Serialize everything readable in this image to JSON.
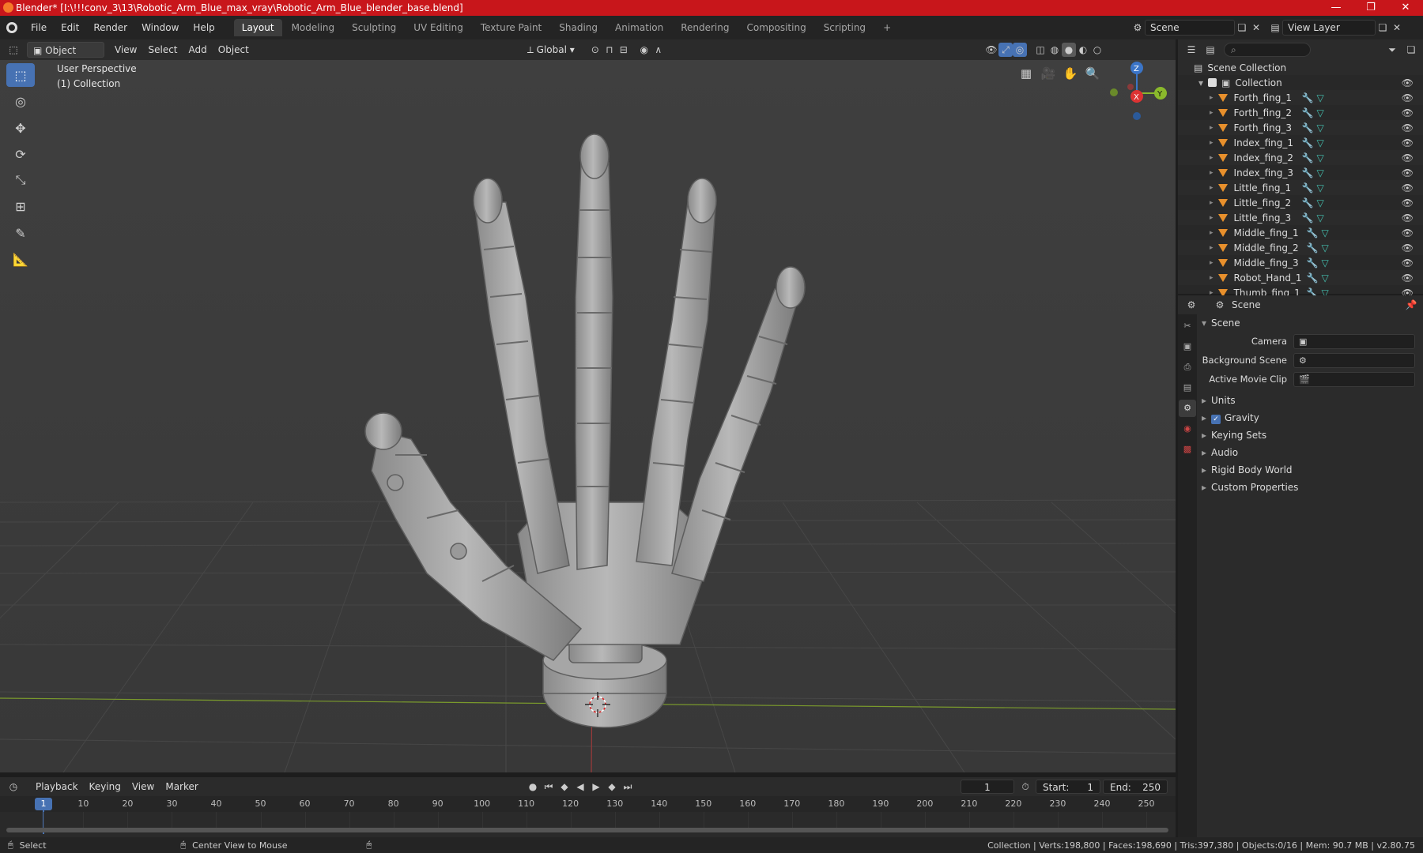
{
  "window": {
    "title": "Blender* [I:\\!!!conv_3\\13\\Robotic_Arm_Blue_max_vray\\Robotic_Arm_Blue_blender_base.blend]",
    "minimize": "—",
    "maximize": "❐",
    "close": "✕"
  },
  "menubar": {
    "items": [
      "File",
      "Edit",
      "Render",
      "Window",
      "Help"
    ],
    "workspaces": [
      "Layout",
      "Modeling",
      "Sculpting",
      "UV Editing",
      "Texture Paint",
      "Shading",
      "Animation",
      "Rendering",
      "Compositing",
      "Scripting"
    ],
    "add_workspace": "+",
    "scene": "Scene",
    "view_layer": "View Layer"
  },
  "viewport_header": {
    "mode": "Object Mode",
    "menus": [
      "View",
      "Select",
      "Add",
      "Object"
    ],
    "orientation": "Global"
  },
  "viewport": {
    "perspective": "User Perspective",
    "collection": "(1) Collection",
    "gizmo": {
      "z": "Z",
      "y": "Y",
      "x": "X"
    }
  },
  "outliner": {
    "root": "Scene Collection",
    "collection": "Collection",
    "objects": [
      "Forth_fing_1",
      "Forth_fing_2",
      "Forth_fing_3",
      "Index_fing_1",
      "Index_fing_2",
      "Index_fing_3",
      "Little_fing_1",
      "Little_fing_2",
      "Little_fing_3",
      "Middle_fing_1",
      "Middle_fing_2",
      "Middle_fing_3",
      "Robot_Hand_1",
      "Thumb_fing_1"
    ]
  },
  "properties": {
    "context": "Scene",
    "panel_scene": "Scene",
    "fields": [
      {
        "label": "Camera",
        "value": ""
      },
      {
        "label": "Background Scene",
        "value": ""
      },
      {
        "label": "Active Movie Clip",
        "value": ""
      }
    ],
    "panels": [
      "Units",
      "Gravity",
      "Keying Sets",
      "Audio",
      "Rigid Body World",
      "Custom Properties"
    ],
    "gravity_checked": true
  },
  "timeline": {
    "menus": [
      "Playback",
      "Keying",
      "View",
      "Marker"
    ],
    "current_frame": "1",
    "start_label": "Start:",
    "start": "1",
    "end_label": "End:",
    "end": "250",
    "ticks": [
      "1",
      "10",
      "20",
      "30",
      "40",
      "50",
      "60",
      "70",
      "80",
      "90",
      "100",
      "110",
      "120",
      "130",
      "140",
      "150",
      "160",
      "170",
      "180",
      "190",
      "200",
      "210",
      "220",
      "230",
      "240",
      "250"
    ]
  },
  "statusbar": {
    "select": "Select",
    "center": "Center View to Mouse",
    "stats": "Collection | Verts:198,800 | Faces:198,690 | Tris:397,380 | Objects:0/16 | Mem: 90.7 MB | v2.80.75"
  },
  "colors": {
    "titlebar": "#c8161b",
    "accent": "#4772b3",
    "object_icon": "#e8902c",
    "mesh_icon": "#44c0b0"
  }
}
